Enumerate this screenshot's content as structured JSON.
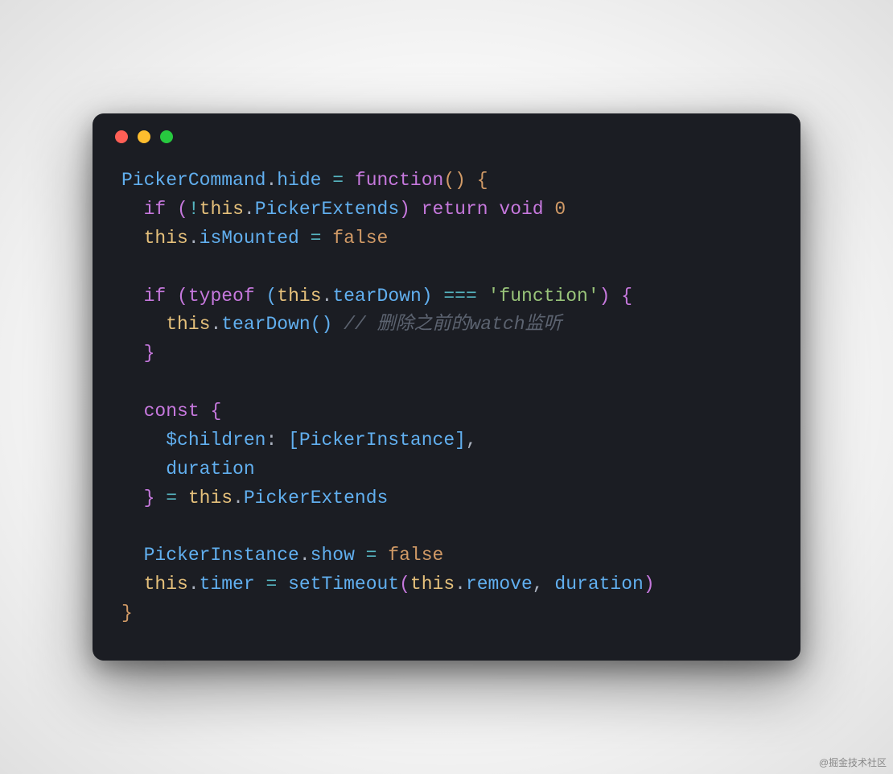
{
  "window": {
    "buttons": [
      "close",
      "minimize",
      "zoom"
    ]
  },
  "code": {
    "l1_PickerCommand": "PickerCommand",
    "l1_dot1": ".",
    "l1_hide": "hide",
    "l1_eq": " = ",
    "l1_function": "function",
    "l1_paren": "()",
    "l1_sp": " ",
    "l1_brace": "{",
    "l2_indent": "  ",
    "l2_if": "if",
    "l2_sp": " ",
    "l2_lp": "(",
    "l2_bang": "!",
    "l2_this": "this",
    "l2_dot": ".",
    "l2_PickerExtends": "PickerExtends",
    "l2_rp": ")",
    "l2_sp2": " ",
    "l2_return": "return",
    "l2_sp3": " ",
    "l2_void": "void",
    "l2_sp4": " ",
    "l2_zero": "0",
    "l3_indent": "  ",
    "l3_this": "this",
    "l3_dot": ".",
    "l3_isMounted": "isMounted",
    "l3_eq": " = ",
    "l3_false": "false",
    "l4_blank": "",
    "l5_indent": "  ",
    "l5_if": "if",
    "l5_sp": " ",
    "l5_lp1": "(",
    "l5_typeof": "typeof",
    "l5_sp2": " ",
    "l5_lp2": "(",
    "l5_this": "this",
    "l5_dot": ".",
    "l5_tearDown": "tearDown",
    "l5_rp2": ")",
    "l5_sp3": " ",
    "l5_eqeqeq": "===",
    "l5_sp4": " ",
    "l5_str": "'function'",
    "l5_rp1": ")",
    "l5_sp5": " ",
    "l5_brace": "{",
    "l6_indent": "    ",
    "l6_this": "this",
    "l6_dot": ".",
    "l6_tearDown": "tearDown",
    "l6_paren": "()",
    "l6_sp": " ",
    "l6_comment": "// 删除之前的watch监听",
    "l7_indent": "  ",
    "l7_brace": "}",
    "l8_blank": "",
    "l9_indent": "  ",
    "l9_const": "const",
    "l9_sp": " ",
    "l9_brace": "{",
    "l10_indent": "    ",
    "l10_children": "$children",
    "l10_colon": ":",
    "l10_sp": " ",
    "l10_lb": "[",
    "l10_PickerInstance": "PickerInstance",
    "l10_rb": "]",
    "l10_comma": ",",
    "l11_indent": "    ",
    "l11_duration": "duration",
    "l12_indent": "  ",
    "l12_brace": "}",
    "l12_eq": " = ",
    "l12_this": "this",
    "l12_dot": ".",
    "l12_PickerExtends": "PickerExtends",
    "l13_blank": "",
    "l14_indent": "  ",
    "l14_PickerInstance": "PickerInstance",
    "l14_dot": ".",
    "l14_show": "show",
    "l14_eq": " = ",
    "l14_false": "false",
    "l15_indent": "  ",
    "l15_this": "this",
    "l15_dot": ".",
    "l15_timer": "timer",
    "l15_eq": " = ",
    "l15_setTimeout": "setTimeout",
    "l15_lp": "(",
    "l15_this2": "this",
    "l15_dot2": ".",
    "l15_remove": "remove",
    "l15_comma": ",",
    "l15_sp": " ",
    "l15_duration": "duration",
    "l15_rp": ")",
    "l16_brace": "}"
  },
  "watermark": "@掘金技术社区"
}
